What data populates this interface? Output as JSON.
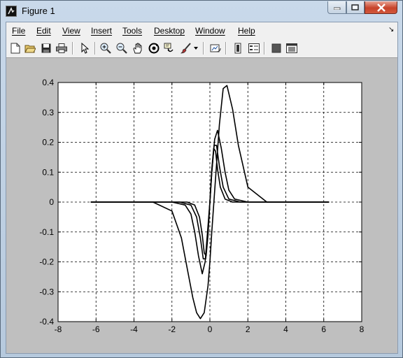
{
  "window": {
    "title": "Figure 1"
  },
  "menu": {
    "items": [
      "File",
      "Edit",
      "View",
      "Insert",
      "Tools",
      "Desktop",
      "Window",
      "Help"
    ]
  },
  "toolbar": {
    "tools": [
      {
        "name": "new-figure-icon"
      },
      {
        "name": "open-file-icon"
      },
      {
        "name": "save-icon"
      },
      {
        "name": "print-icon"
      },
      {
        "name": "edit-plot-arrow-icon"
      },
      {
        "name": "zoom-in-icon"
      },
      {
        "name": "zoom-out-icon"
      },
      {
        "name": "pan-hand-icon"
      },
      {
        "name": "rotate-3d-icon"
      },
      {
        "name": "data-cursor-icon"
      },
      {
        "name": "brush-icon"
      },
      {
        "name": "link-plot-icon"
      },
      {
        "name": "insert-colorbar-icon"
      },
      {
        "name": "insert-legend-icon"
      },
      {
        "name": "hide-plot-tools-icon"
      },
      {
        "name": "show-plot-tools-icon"
      }
    ]
  },
  "chart_data": {
    "type": "line",
    "title": "",
    "xlabel": "",
    "ylabel": "",
    "xlim": [
      -8,
      8
    ],
    "ylim": [
      -0.4,
      0.4
    ],
    "xticks": [
      "-8",
      "-6",
      "-4",
      "-2",
      "0",
      "2",
      "4",
      "6",
      "8"
    ],
    "yticks": [
      "0.4",
      "0.3",
      "0.2",
      "0.1",
      "0",
      "-0.1",
      "-0.2",
      "-0.3",
      "-0.4"
    ],
    "grid": true,
    "line_color": "#000000",
    "series": [
      {
        "x": [
          -6.28,
          -3,
          -2,
          -1.5,
          -1.2,
          -0.9,
          -0.7,
          -0.5,
          -0.3,
          -0.1,
          0,
          0.1,
          0.3,
          0.5,
          0.7,
          0.9,
          1.2,
          1.5,
          2,
          3,
          6.28
        ],
        "y": [
          0,
          0,
          -0.03,
          -0.12,
          -0.22,
          -0.32,
          -0.37,
          -0.39,
          -0.37,
          -0.28,
          -0.2,
          -0.1,
          0.08,
          0.26,
          0.38,
          0.39,
          0.31,
          0.19,
          0.05,
          0,
          0
        ]
      },
      {
        "x": [
          -6.28,
          -2,
          -1.3,
          -1,
          -0.8,
          -0.6,
          -0.4,
          -0.25,
          -0.1,
          0,
          0.1,
          0.25,
          0.4,
          0.6,
          0.8,
          1,
          1.3,
          2,
          6.28
        ],
        "y": [
          0,
          0,
          -0.01,
          -0.04,
          -0.1,
          -0.18,
          -0.24,
          -0.2,
          -0.08,
          0,
          0.1,
          0.21,
          0.24,
          0.18,
          0.1,
          0.04,
          0.01,
          0,
          0
        ]
      },
      {
        "x": [
          -6.28,
          -1.6,
          -1,
          -0.7,
          -0.5,
          -0.35,
          -0.22,
          -0.1,
          0,
          0.1,
          0.22,
          0.35,
          0.5,
          0.7,
          1,
          1.6,
          6.28
        ],
        "y": [
          0,
          0,
          -0.01,
          -0.05,
          -0.12,
          -0.19,
          -0.19,
          -0.1,
          0,
          0.1,
          0.19,
          0.19,
          0.12,
          0.05,
          0.01,
          0,
          0
        ]
      },
      {
        "x": [
          -6.28,
          -1.2,
          -0.8,
          -0.55,
          -0.4,
          -0.3,
          -0.2,
          -0.1,
          0,
          0.1,
          0.2,
          0.3,
          0.4,
          0.55,
          0.8,
          1.2,
          6.28
        ],
        "y": [
          0,
          0,
          -0.01,
          -0.05,
          -0.11,
          -0.17,
          -0.18,
          -0.11,
          0,
          0.11,
          0.18,
          0.17,
          0.11,
          0.05,
          0.01,
          0,
          0
        ]
      }
    ]
  }
}
